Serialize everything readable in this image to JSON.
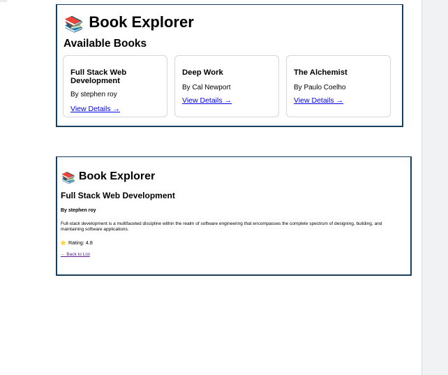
{
  "list_view": {
    "emoji": "📚",
    "title": "Book Explorer",
    "subtitle": "Available Books",
    "books": [
      {
        "title": "Full Stack Web Development",
        "author": "By stephen roy",
        "link": "View Details →"
      },
      {
        "title": "Deep Work",
        "author": "By Cal Newport",
        "link": "View Details →"
      },
      {
        "title": "The Alchemist",
        "author": "By Paulo Coelho",
        "link": "View Details →"
      }
    ]
  },
  "detail_view": {
    "emoji": "📚",
    "title": "Book Explorer",
    "book_title": "Full Stack Web Development",
    "author": "By stephen roy",
    "description": "Full-stack development is a multifaceted discipline within the realm of software engineering that encompasses the complete spectrum of designing, building, and maintaining software applications.",
    "rating_icon": "⭐",
    "rating": "Rating: 4.8",
    "back_link": "← Back to List"
  },
  "colors": {
    "panel_border": "#173e5a",
    "link": "#0000ee",
    "visited_link": "#551a8b"
  }
}
